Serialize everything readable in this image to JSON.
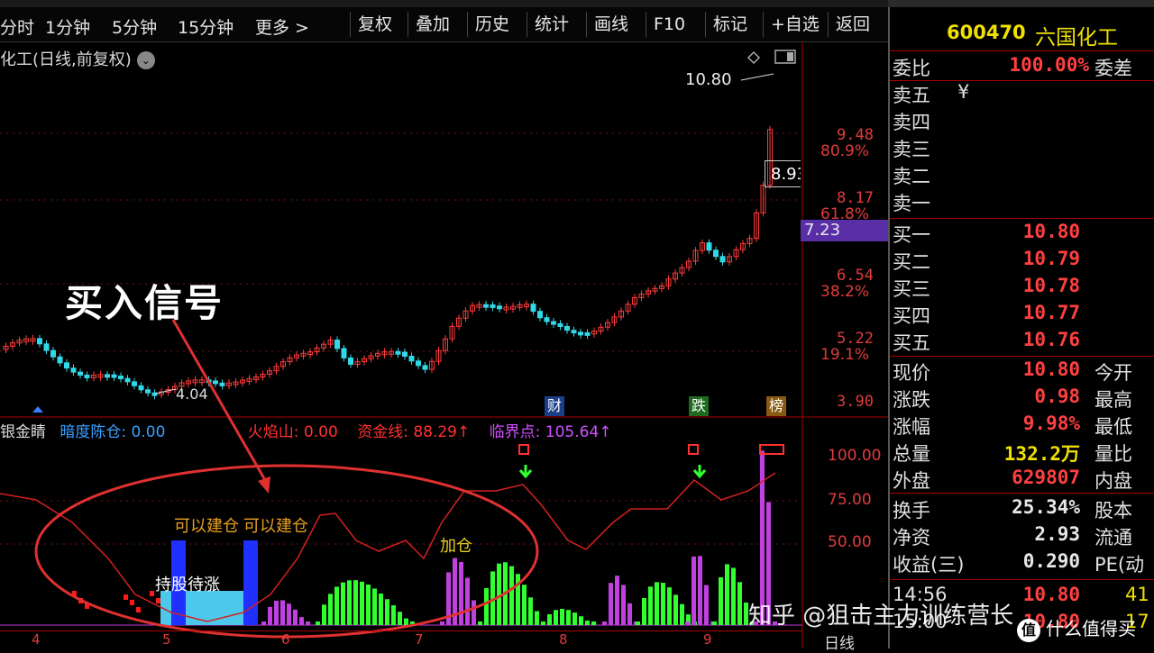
{
  "toolbar": {
    "period_tabs": [
      "分时",
      "1分钟",
      "5分钟",
      "15分钟",
      "更多 >"
    ],
    "buttons": [
      "复权",
      "叠加",
      "历史",
      "统计",
      "画线",
      "F10",
      "标记",
      "+自选",
      "返回"
    ]
  },
  "chart": {
    "title": "化工(日线,前复权)",
    "high_label": "10.80",
    "low_label": "4.04",
    "current_tag": "7.23",
    "hover_price": "8.93",
    "price_axis": [
      {
        "price": "9.48",
        "pct": "80.9%"
      },
      {
        "price": "8.17",
        "pct": "61.8%"
      },
      {
        "price": "6.54",
        "pct": "38.2%"
      },
      {
        "price": "5.22",
        "pct": "19.1%"
      },
      {
        "price": "3.90",
        "pct": ""
      }
    ],
    "events": [
      "财",
      "跌",
      "榜"
    ],
    "annotation": "买入信号"
  },
  "indicator": {
    "name": "银金睛",
    "items": [
      {
        "label": "暗度陈仓: 0.00",
        "color": "#3aa0ff"
      },
      {
        "label": "火焰山: 0.00",
        "color": "#ff3030"
      },
      {
        "label": "资金线: 88.29↑",
        "color": "#ff3030"
      },
      {
        "label": "临界点: 105.64↑",
        "color": "#d050ff"
      }
    ],
    "axis": [
      "100.00",
      "75.00",
      "50.00"
    ],
    "signals": {
      "build1": "可以建仓",
      "build2": "可以建仓",
      "hold": "持股待涨",
      "add": "加仓"
    }
  },
  "date_axis": [
    "4",
    "5",
    "6",
    "7",
    "8",
    "9"
  ],
  "period_label": "日线",
  "panel": {
    "code": "600470",
    "name": "六国化工",
    "weibi": {
      "label": "委比",
      "value": "100.00%",
      "right": "委差"
    },
    "sell": [
      {
        "label": "卖五",
        "value": "¥"
      },
      {
        "label": "卖四",
        "value": ""
      },
      {
        "label": "卖三",
        "value": ""
      },
      {
        "label": "卖二",
        "value": ""
      },
      {
        "label": "卖一",
        "value": ""
      }
    ],
    "buy": [
      {
        "label": "买一",
        "value": "10.80"
      },
      {
        "label": "买二",
        "value": "10.79"
      },
      {
        "label": "买三",
        "value": "10.78"
      },
      {
        "label": "买四",
        "value": "10.77"
      },
      {
        "label": "买五",
        "value": "10.76"
      }
    ],
    "stats": [
      {
        "label": "现价",
        "value": "10.80",
        "right": "今开",
        "color": "r"
      },
      {
        "label": "涨跌",
        "value": "0.98",
        "right": "最高",
        "color": "r"
      },
      {
        "label": "涨幅",
        "value": "9.98%",
        "right": "最低",
        "color": "r"
      },
      {
        "label": "总量",
        "value": "132.2万",
        "right": "量比",
        "color": "y"
      },
      {
        "label": "外盘",
        "value": "629807",
        "right": "内盘",
        "color": "r"
      }
    ],
    "stats2": [
      {
        "label": "换手",
        "value": "25.34%",
        "right": "股本",
        "color": "w"
      },
      {
        "label": "净资",
        "value": "2.93",
        "right": "流通",
        "color": "w"
      },
      {
        "label": "收益(三)",
        "value": "0.290",
        "right": "PE(动",
        "color": "w"
      }
    ],
    "ticks": [
      {
        "time": "14:56",
        "value": "10.80",
        "vol": "41"
      },
      {
        "time": "15:00",
        "value": "10.80",
        "vol": "17"
      }
    ]
  },
  "watermark": {
    "text": "知乎 @狙击主力训练营长",
    "logo": "值",
    "text2": "什么值得买"
  }
}
